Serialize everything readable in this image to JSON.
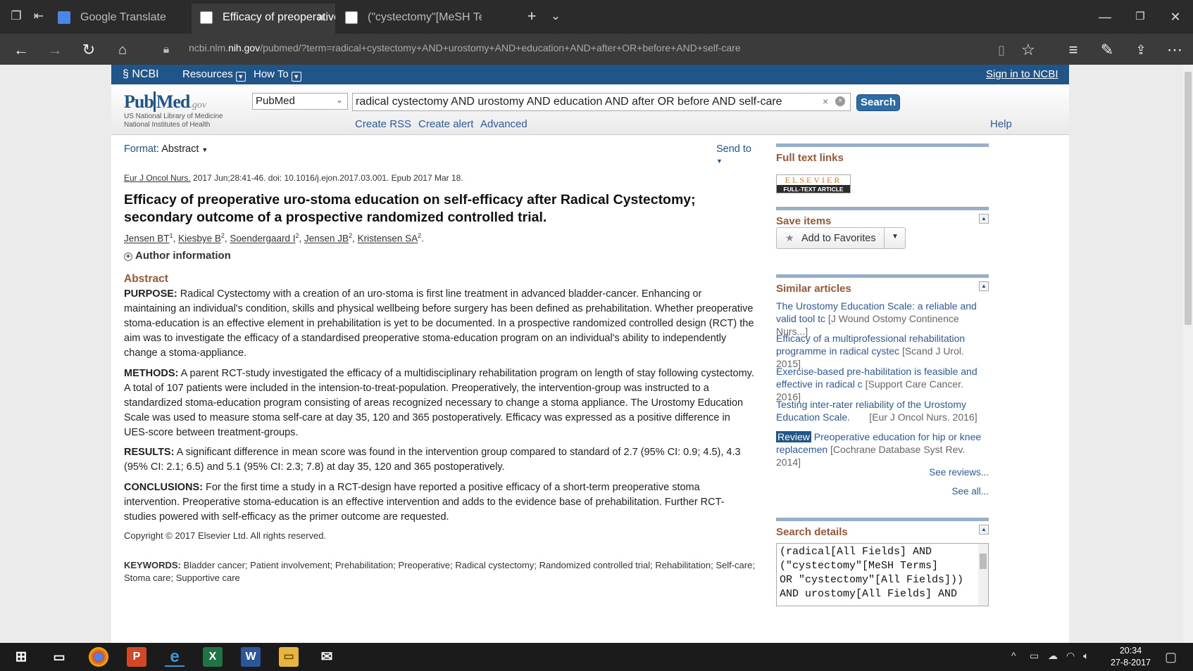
{
  "browser": {
    "tabs": [
      {
        "label": "Google Translate",
        "active": false
      },
      {
        "label": "Efficacy of preoperative",
        "active": true
      },
      {
        "label": "(\"cystectomy\"[MeSH Terms]",
        "active": false
      }
    ],
    "url_domain_pre": "ncbi.nlm.",
    "url_domain_bold": "nih.gov",
    "url_path": "/pubmed/?term=radical+cystectomy+AND+urostomy+AND+education+AND+after+OR+before+AND+self-care"
  },
  "ncbi": {
    "brand": "NCBI",
    "resources": "Resources",
    "howto": "How To",
    "signin": "Sign in to NCBI"
  },
  "pubmed": {
    "logo_pub": "Pub",
    "logo_med": "Med",
    "logo_gov": ".gov",
    "logo_sub1": "US National Library of Medicine",
    "logo_sub2": "National Institutes of Health",
    "db_value": "PubMed",
    "search_value": "radical cystectomy AND urostomy AND education AND after OR before AND self-care",
    "search_button": "Search",
    "create_rss": "Create RSS",
    "create_alert": "Create alert",
    "advanced": "Advanced",
    "help": "Help"
  },
  "article": {
    "format_label": "Format",
    "format_value": "Abstract",
    "send_to": "Send to",
    "journal": "Eur J Oncol Nurs.",
    "citation_rest": " 2017 Jun;28:41-46. doi: 10.1016/j.ejon.2017.03.001. Epub 2017 Mar 18.",
    "title": "Efficacy of preoperative uro-stoma education on self-efficacy after Radical Cystectomy; secondary outcome of a prospective randomized controlled trial.",
    "authors": [
      {
        "name": "Jensen BT",
        "sup": "1"
      },
      {
        "name": "Kiesbye B",
        "sup": "2"
      },
      {
        "name": "Soendergaard I",
        "sup": "2"
      },
      {
        "name": "Jensen JB",
        "sup": "2"
      },
      {
        "name": "Kristensen SA",
        "sup": "2"
      }
    ],
    "author_info": "Author information",
    "abstract_heading": "Abstract",
    "purpose_label": "PURPOSE:",
    "purpose": " Radical Cystectomy with a creation of an uro-stoma is first line treatment in advanced bladder-cancer. Enhancing or maintaining an individual's condition, skills and physical wellbeing before surgery has been defined as prehabilitation. Whether preoperative stoma-education is an effective element in prehabilitation is yet to be documented. In a prospective randomized controlled design (RCT) the aim was to investigate the efficacy of a standardised preoperative stoma-education program on an individual's ability to independently change a stoma-appliance.",
    "methods_label": "METHODS:",
    "methods": " A parent RCT-study investigated the efficacy of a multidisciplinary rehabilitation program on length of stay following cystectomy. A total of 107 patients were included in the intension-to-treat-population. Preoperatively, the intervention-group was instructed to a standardized stoma-education program consisting of areas recognized necessary to change a stoma appliance. The Urostomy Education Scale was used to measure stoma self-care at day 35, 120 and 365 postoperatively. Efficacy was expressed as a positive difference in UES-score between treatment-groups.",
    "results_label": "RESULTS:",
    "results": " A significant difference in mean score was found in the intervention group compared to standard of 2.7 (95% CI: 0.9; 4.5), 4.3 (95% CI: 2.1; 6.5) and 5.1 (95% CI: 2.3; 7.8) at day 35, 120 and 365 postoperatively.",
    "conclusions_label": "CONCLUSIONS:",
    "conclusions": " For the first time a study in a RCT-design have reported a positive efficacy of a short-term preoperative stoma intervention. Preoperative stoma-education is an effective intervention and adds to the evidence base of prehabilitation. Further RCT-studies powered with self-efficacy as the primer outcome are requested.",
    "copyright": "Copyright © 2017 Elsevier Ltd. All rights reserved.",
    "keywords_label": "KEYWORDS:",
    "keywords": " Bladder cancer; Patient involvement; Prehabilitation; Preoperative; Radical cystectomy; Randomized controlled trial; Rehabilitation; Self-care; Stoma care; Supportive care"
  },
  "sidebar": {
    "fulltext_heading": "Full text links",
    "elsevier_top": "ELSEVIER",
    "elsevier_bottom": "FULL-TEXT ARTICLE",
    "save_heading": "Save items",
    "add_favorites": "Add to Favorites",
    "similar_heading": "Similar articles",
    "similar": [
      {
        "badge": "",
        "title_a": "The Urostomy Education Scale: a reliable and",
        "title_b": "valid tool tc",
        "source": " [J Wound Ostomy Continence Nurs...]"
      },
      {
        "badge": "",
        "title_a": "Efficacy of a multiprofessional rehabilitation",
        "title_b": "programme in radical cystec",
        "source": " [Scand J Urol. 2015]"
      },
      {
        "badge": "",
        "title_a": "Exercise-based pre-habilitation is feasible and",
        "title_b": "effective in radical c",
        "source": " [Support Care Cancer. 2016]"
      },
      {
        "badge": "",
        "title_a": "Testing inter-rater reliability of the Urostomy",
        "title_b": "Education Scale.",
        "source": "       [Eur J Oncol Nurs. 2016]"
      },
      {
        "badge": "Review",
        "title_a": " Preoperative education for hip or knee",
        "title_b": "replacemen",
        "source": " [Cochrane Database Syst Rev. 2014]"
      }
    ],
    "see_reviews": "See reviews...",
    "see_all": "See all...",
    "details_heading": "Search details",
    "details_text": "(radical[All Fields] AND\n(\"cystectomy\"[MeSH Terms]\nOR \"cystectomy\"[All Fields]))\nAND urostomy[All Fields] AND"
  },
  "taskbar": {
    "time": "20:34",
    "date": "27-8-2017"
  }
}
